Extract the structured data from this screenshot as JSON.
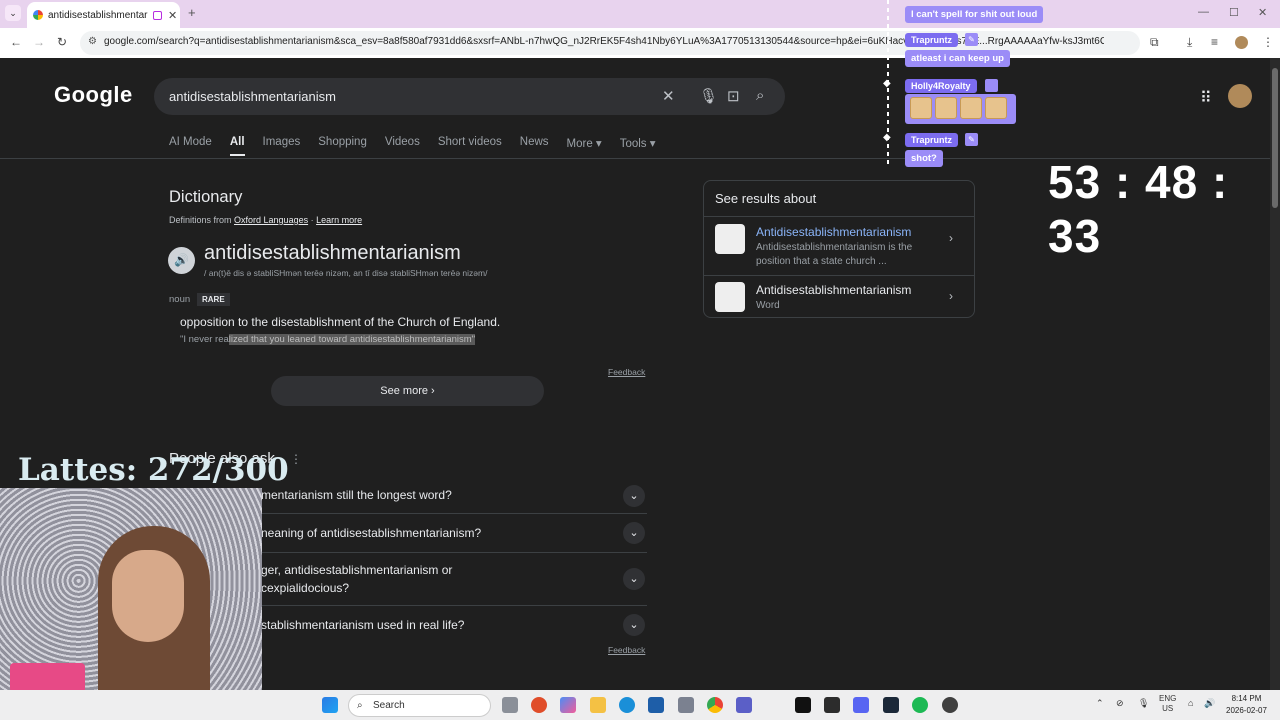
{
  "browser": {
    "tab_title": "antidisestablishmentarianis",
    "tab_close": "✕",
    "new_tab": "+",
    "url": "google.com/search?q=antidisestablishmentarianism&sca_esv=8a8f580af7931dd6&sxsrf=ANbL-n7hwQG_nJ2RrEK5F4sh41Nby6YLuA%3A1770513130544&source=hp&ei=6uKHacvfHsydptQPs7LE...RrgAAAAAaYfw-ksJ3mt6G...",
    "window_controls": [
      "—",
      "☐",
      "✕"
    ]
  },
  "google": {
    "logo": "Google",
    "query": "antidisestablishmentarianism",
    "tabs": [
      "AI Mode",
      "All",
      "Images",
      "Shopping",
      "Videos",
      "Short videos",
      "News",
      "More ▾",
      "Tools ▾"
    ],
    "dictionary": {
      "heading": "Dictionary",
      "source_prefix": "Definitions from ",
      "source_name": "Oxford Languages",
      "source_sep": " · ",
      "learn_more": "Learn more",
      "word": "antidisestablishmentarianism",
      "phonetic": "/ an(t)ē dis ə stabliSHmən terēə nizəm, an tī disə stabliSHmən terēə nizəm/",
      "pos": "noun",
      "badge": "RARE",
      "definition": "opposition to the disestablishment of the Church of England.",
      "example_start": "\"I never rea",
      "example_highlight": "lized that you leaned toward antidisestablishmentarianism\"",
      "feedback": "Feedback",
      "see_more": "See more"
    },
    "paa": {
      "heading": "People also ask",
      "questions": [
        "Is antidisestablishmentarianism still the longest word?",
        "What is the meaning of antidisestablishmentarianism?",
        "Which is longer, antidisestablishmentarianism or",
        "supercalifragilisticexpialidocious?",
        "Is antidisestablishmentarianism used in real life?"
      ],
      "question_tails": [
        "mentarianism still the longest word?",
        "neaning of antidisestablishmentarianism?",
        "ger, antidisestablishmentarianism or",
        "cexpialidocious?",
        "stablishmentarianism used in real life?"
      ],
      "feedback": "Feedback"
    },
    "side_panel": {
      "heading": "See results about",
      "items": [
        {
          "title": "Antidisestablishmentarianism",
          "desc": "Antidisestablishmentarianism is the position that a state church ..."
        },
        {
          "title": "Antidisestablishmentarianism",
          "desc": "Word"
        }
      ]
    }
  },
  "stream": {
    "chat": [
      {
        "user": "",
        "message": "I can't spell for shit out loud"
      },
      {
        "user": "Trapruntz",
        "message": "atleast i can keep up"
      },
      {
        "user": "Holly4Royalty",
        "message": ""
      },
      {
        "user": "Trapruntz",
        "message": "shot?"
      }
    ],
    "timer": "53 : 48 : 33",
    "lattes": "Lattes: 272/300"
  },
  "taskbar": {
    "search_label": "Search",
    "lang": "ENG",
    "region": "US",
    "time": "8:14 PM",
    "date": "2026-02-07"
  }
}
